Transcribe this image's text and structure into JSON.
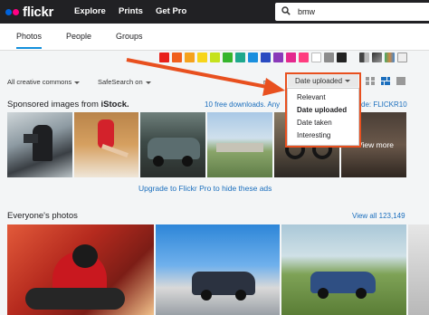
{
  "header": {
    "logo_text": "flickr",
    "nav": [
      "Explore",
      "Prints",
      "Get Pro"
    ],
    "search_value": "bmw"
  },
  "tabs": [
    "Photos",
    "People",
    "Groups"
  ],
  "color_swatches": [
    "#e8201a",
    "#f0601e",
    "#f5a21e",
    "#f7d51b",
    "#c5e21d",
    "#36b52d",
    "#1ea88c",
    "#1a8fde",
    "#2a4bc1",
    "#8a3ab9",
    "#e4298e",
    "#ff3d7f",
    "#ffffff",
    "#8c8c8c",
    "#222222"
  ],
  "filters": {
    "license": "All creative commons",
    "safesearch": "SafeSearch on",
    "sort_partial": "rt",
    "sort_current": "Date uploaded"
  },
  "sort_menu": {
    "items": [
      "Relevant",
      "Date uploaded",
      "Date taken",
      "Interesting"
    ],
    "selected_index": 1
  },
  "sponsored": {
    "title_prefix": "Sponsored images from ",
    "brand": "iStock.",
    "downloads_link": "10 free downloads. Any",
    "code_suffix": "de: FLICKR10",
    "view_more": "View more",
    "upgrade": "Upgrade to Flickr Pro to hide these ads"
  },
  "everyone": {
    "title": "Everyone's photos",
    "view_all": "View all 123,149"
  }
}
